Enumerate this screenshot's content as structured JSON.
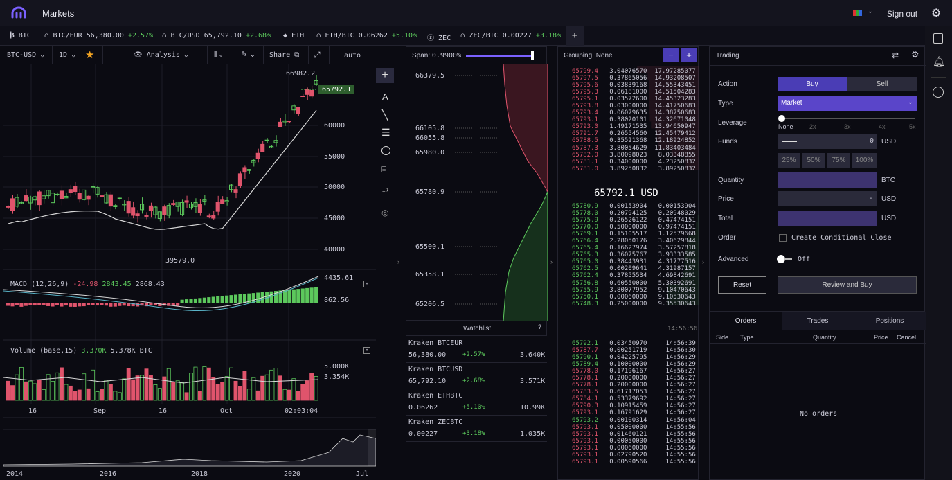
{
  "header": {
    "title": "Markets",
    "sign_out": "Sign out"
  },
  "tickers": [
    {
      "sym": "BTC",
      "price": "",
      "change": ""
    },
    {
      "sym": "BTC/EUR",
      "price": "56,380.00",
      "change": "+2.57%"
    },
    {
      "sym": "BTC/USD",
      "price": "65,792.10",
      "change": "+2.68%"
    },
    {
      "sym": "ETH",
      "price": "",
      "change": ""
    },
    {
      "sym": "ETH/BTC",
      "price": "0.06262",
      "change": "+5.10%"
    },
    {
      "sym": "ZEC",
      "price": "",
      "change": ""
    },
    {
      "sym": "ZEC/BTC",
      "price": "0.00227",
      "change": "+3.18%"
    }
  ],
  "toolbar": {
    "pair": "BTC-USD",
    "interval": "1D",
    "analysis": "Analysis",
    "share": "Share",
    "auto": "auto"
  },
  "chart": {
    "ylabels": [
      "66982.2",
      "65792.1",
      "60000",
      "55000",
      "50000",
      "45000",
      "40000"
    ],
    "low_label": "39579.0",
    "macd": {
      "label": "MACD (12,26,9)",
      "v1": "-24.98",
      "v2": "2843.45",
      "v3": "2868.43",
      "y1": "4435.61",
      "y2": "862.56"
    },
    "volume": {
      "label": "Volume (base,15)",
      "v1": "3.370K",
      "v2": "5.378K BTC",
      "y1": "5.000K",
      "y2": "3.354K"
    },
    "xlabels": [
      "16",
      "Sep",
      "16",
      "Oct",
      "02:03:04"
    ],
    "overview_x": [
      "2014",
      "2016",
      "2018",
      "2020",
      "Jul"
    ]
  },
  "depth": {
    "span_label": "Span:",
    "span_value": "0.9900%",
    "levels": [
      "66379.5",
      "66105.8",
      "66055.8",
      "65980.0",
      "65780.9",
      "65500.1",
      "65358.1",
      "65206.5"
    ]
  },
  "watchlist": {
    "title": "Watchlist",
    "items": [
      {
        "name": "Kraken BTCEUR",
        "price": "56,380.00",
        "change": "+2.57%",
        "vol": "3.640K"
      },
      {
        "name": "Kraken BTCUSD",
        "price": "65,792.10",
        "change": "+2.68%",
        "vol": "3.571K"
      },
      {
        "name": "Kraken ETHBTC",
        "price": "0.06262",
        "change": "+5.10%",
        "vol": "10.99K"
      },
      {
        "name": "Kraken ZECBTC",
        "price": "0.00227",
        "change": "+3.18%",
        "vol": "1.035K"
      }
    ]
  },
  "orderbook": {
    "grouping": "Grouping: None",
    "asks": [
      [
        "65799.4",
        "3.04076570",
        "17.97285077"
      ],
      [
        "65797.5",
        "0.37865056",
        "14.93208507"
      ],
      [
        "65795.6",
        "0.03839168",
        "14.55343451"
      ],
      [
        "65795.3",
        "0.06181000",
        "14.51504283"
      ],
      [
        "65795.1",
        "0.03572600",
        "14.45323283"
      ],
      [
        "65793.8",
        "0.03000000",
        "14.41750683"
      ],
      [
        "65793.4",
        "0.06079635",
        "14.38750683"
      ],
      [
        "65793.1",
        "0.38020101",
        "14.32671048"
      ],
      [
        "65793.0",
        "1.49171535",
        "13.94650947"
      ],
      [
        "65791.7",
        "0.26554560",
        "12.45479412"
      ],
      [
        "65788.5",
        "0.35521368",
        "12.18924852"
      ],
      [
        "65787.3",
        "3.80054629",
        "11.83403484"
      ],
      [
        "65782.0",
        "3.80098023",
        "8.03348855"
      ],
      [
        "65781.1",
        "0.34000000",
        "4.23250832"
      ],
      [
        "65781.0",
        "3.89250832",
        "3.89250832"
      ]
    ],
    "mid": "65792.1 USD",
    "bids": [
      [
        "65780.9",
        "0.00153904",
        "0.00153904"
      ],
      [
        "65778.0",
        "0.20794125",
        "0.20948029"
      ],
      [
        "65775.9",
        "0.26526122",
        "0.47474151"
      ],
      [
        "65770.0",
        "0.50000000",
        "0.97474151"
      ],
      [
        "65769.1",
        "0.15105517",
        "1.12579668"
      ],
      [
        "65766.4",
        "2.28050176",
        "3.40629844"
      ],
      [
        "65765.4",
        "0.16627974",
        "3.57257818"
      ],
      [
        "65765.3",
        "0.36075767",
        "3.93333585"
      ],
      [
        "65765.0",
        "0.38443931",
        "4.31777516"
      ],
      [
        "65762.5",
        "0.00209641",
        "4.31987157"
      ],
      [
        "65762.4",
        "0.37855534",
        "4.69842691"
      ],
      [
        "65756.8",
        "0.60550000",
        "5.30392691"
      ],
      [
        "65755.9",
        "3.80077952",
        "9.10470643"
      ],
      [
        "65750.1",
        "0.00060000",
        "9.10530643"
      ],
      [
        "65748.3",
        "0.25000000",
        "9.35530643"
      ]
    ],
    "time": "14:56:56",
    "trades": [
      [
        "65792.1",
        "0.03450970",
        "14:56:39",
        "g"
      ],
      [
        "65787.7",
        "0.00251719",
        "14:56:30",
        "r"
      ],
      [
        "65790.1",
        "0.04225795",
        "14:56:29",
        "g"
      ],
      [
        "65789.4",
        "0.10000000",
        "14:56:29",
        "g"
      ],
      [
        "65778.0",
        "0.17196167",
        "14:56:27",
        "r"
      ],
      [
        "65778.1",
        "0.20000000",
        "14:56:27",
        "r"
      ],
      [
        "65778.1",
        "0.20000000",
        "14:56:27",
        "r"
      ],
      [
        "65783.5",
        "0.61717053",
        "14:56:27",
        "r"
      ],
      [
        "65784.1",
        "0.53379692",
        "14:56:27",
        "r"
      ],
      [
        "65790.3",
        "0.10915459",
        "14:56:27",
        "r"
      ],
      [
        "65793.1",
        "0.16791629",
        "14:56:27",
        "r"
      ],
      [
        "65793.2",
        "0.00100314",
        "14:56:04",
        "g"
      ],
      [
        "65793.1",
        "0.05000000",
        "14:55:56",
        "r"
      ],
      [
        "65793.1",
        "0.01460121",
        "14:55:56",
        "r"
      ],
      [
        "65793.1",
        "0.00050000",
        "14:55:56",
        "r"
      ],
      [
        "65793.1",
        "0.00060000",
        "14:55:56",
        "r"
      ],
      [
        "65793.1",
        "0.02790520",
        "14:55:56",
        "r"
      ],
      [
        "65793.1",
        "0.00590566",
        "14:55:56",
        "r"
      ]
    ]
  },
  "trading": {
    "title": "Trading",
    "action": "Action",
    "buy": "Buy",
    "sell": "Sell",
    "type": "Type",
    "type_value": "Market",
    "leverage": "Leverage",
    "lev_ticks": [
      "None",
      "2x",
      "3x",
      "4x",
      "5x"
    ],
    "funds": "Funds",
    "funds_value": "0",
    "funds_unit": "USD",
    "pcts": [
      "25%",
      "50%",
      "75%",
      "100%"
    ],
    "quantity": "Quantity",
    "qty_unit": "BTC",
    "price": "Price",
    "price_value": "-",
    "price_unit": "USD",
    "total": "Total",
    "total_unit": "USD",
    "order": "Order",
    "conditional": "Create Conditional Close",
    "advanced": "Advanced",
    "advanced_value": "Off",
    "reset": "Reset",
    "review": "Review and Buy"
  },
  "orders": {
    "tabs": [
      "Orders",
      "Trades",
      "Positions"
    ],
    "cols": [
      "Side",
      "Type",
      "Quantity",
      "Price",
      "Cancel"
    ],
    "empty": "No orders"
  }
}
